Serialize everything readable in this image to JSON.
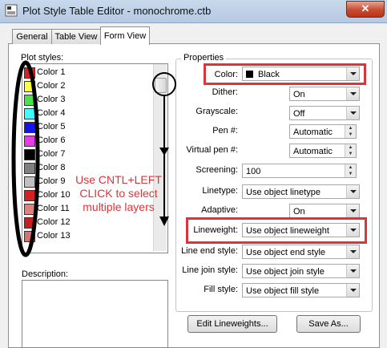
{
  "window": {
    "title": "Plot Style Table Editor - monochrome.ctb",
    "close_glyph": "✕"
  },
  "tabs": [
    {
      "label": "General"
    },
    {
      "label": "Table View"
    },
    {
      "label": "Form View"
    }
  ],
  "plot_styles": {
    "label": "Plot styles:",
    "items": [
      {
        "label": "Color 1",
        "swatch": "#e02020"
      },
      {
        "label": "Color 2",
        "swatch": "#ffff3c"
      },
      {
        "label": "Color 3",
        "swatch": "#4de04d"
      },
      {
        "label": "Color 4",
        "swatch": "#3cffff"
      },
      {
        "label": "Color 5",
        "swatch": "#1414e6"
      },
      {
        "label": "Color 6",
        "swatch": "#e63ce6"
      },
      {
        "label": "Color 7",
        "swatch": "#000000"
      },
      {
        "label": "Color 8",
        "swatch": "#808080"
      },
      {
        "label": "Color 9",
        "swatch": "#c0c0c0"
      },
      {
        "label": "Color 10",
        "swatch": "#d42020"
      },
      {
        "label": "Color 11",
        "swatch": "#e08080"
      },
      {
        "label": "Color 12",
        "swatch": "#c81e1e"
      },
      {
        "label": "Color 13",
        "swatch": "#d87070"
      }
    ]
  },
  "description": {
    "label": "Description:"
  },
  "properties": {
    "title": "Properties",
    "color": {
      "label": "Color:",
      "value": "Black",
      "swatch": "#000000"
    },
    "dither": {
      "label": "Dither:",
      "value": "On"
    },
    "grayscale": {
      "label": "Grayscale:",
      "value": "Off"
    },
    "pen": {
      "label": "Pen #:",
      "value": "Automatic"
    },
    "virtual_pen": {
      "label": "Virtual pen #:",
      "value": "Automatic"
    },
    "screening": {
      "label": "Screening:",
      "value": "100"
    },
    "linetype": {
      "label": "Linetype:",
      "value": "Use object linetype"
    },
    "adaptive": {
      "label": "Adaptive:",
      "value": "On"
    },
    "lineweight": {
      "label": "Lineweight:",
      "value": "Use object lineweight"
    },
    "line_end": {
      "label": "Line end style:",
      "value": "Use object end style"
    },
    "line_join": {
      "label": "Line join style:",
      "value": "Use object join style"
    },
    "fill": {
      "label": "Fill style:",
      "value": "Use object fill style"
    }
  },
  "buttons": {
    "edit_lineweights": "Edit Lineweights...",
    "save_as": "Save As..."
  },
  "annotation": {
    "line1": "Use CNTL+LEFT",
    "line2": "CLICK to select",
    "line3": "multiple layers"
  },
  "colors": {
    "annotation_red": "#d9363a"
  }
}
